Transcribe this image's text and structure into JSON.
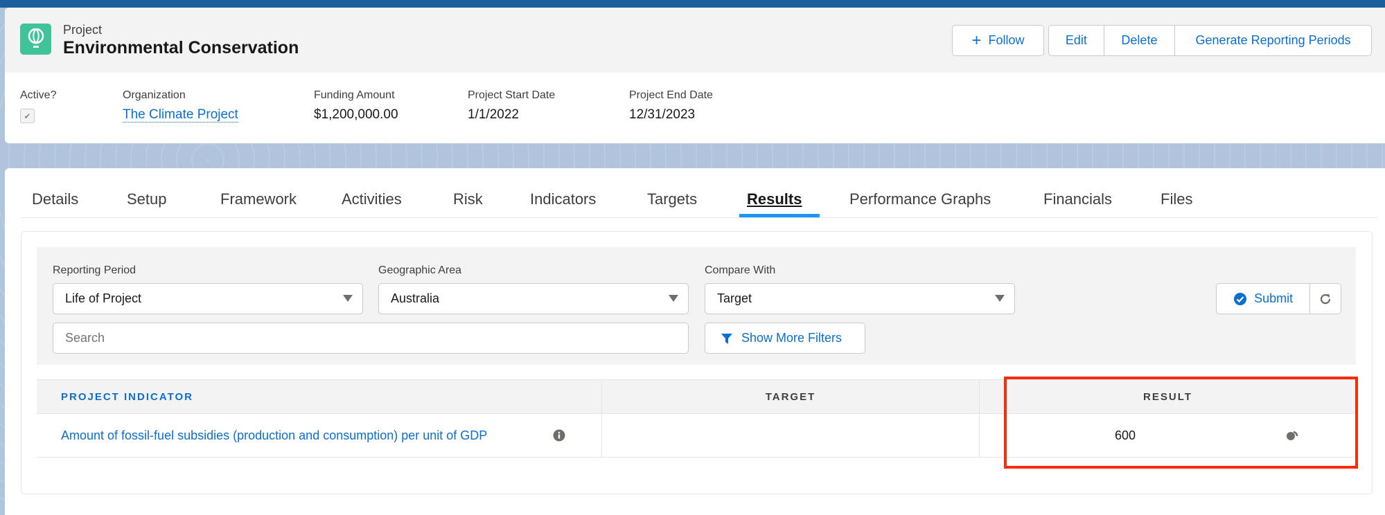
{
  "header": {
    "object_type": "Project",
    "title": "Environmental Conservation",
    "icon": "hot-air-balloon-icon",
    "icon_color": "#41c399",
    "actions": {
      "follow": "Follow",
      "edit": "Edit",
      "delete": "Delete",
      "generate": "Generate Reporting Periods"
    }
  },
  "fields": [
    {
      "label": "Active?",
      "checked": true
    },
    {
      "label": "Organization",
      "value": "The Climate Project"
    },
    {
      "label": "Funding Amount",
      "value": "$1,200,000.00"
    },
    {
      "label": "Project Start Date",
      "value": "1/1/2022"
    },
    {
      "label": "Project End Date",
      "value": "12/31/2023"
    }
  ],
  "tabs": [
    {
      "label": "Details"
    },
    {
      "label": "Setup"
    },
    {
      "label": "Framework"
    },
    {
      "label": "Activities"
    },
    {
      "label": "Risk"
    },
    {
      "label": "Indicators"
    },
    {
      "label": "Targets"
    },
    {
      "label": "Results",
      "active": true
    },
    {
      "label": "Performance Graphs"
    },
    {
      "label": "Financials"
    },
    {
      "label": "Files"
    }
  ],
  "filters": {
    "reporting_period": {
      "label": "Reporting Period",
      "value": "Life of Project"
    },
    "geographic_area": {
      "label": "Geographic Area",
      "value": "Australia"
    },
    "compare_with": {
      "label": "Compare With",
      "value": "Target"
    },
    "search": {
      "placeholder": "Search",
      "value": ""
    },
    "show_more": "Show More Filters",
    "submit": "Submit"
  },
  "table": {
    "columns": [
      "PROJECT INDICATOR",
      "TARGET",
      "RESULT"
    ],
    "rows": [
      {
        "indicator": "Amount of fossil-fuel subsidies (production and consumption) per unit of GDP",
        "target": "",
        "result": "600"
      }
    ]
  },
  "highlight_color": "#ff2a0a",
  "accent_color": "#0b6fd0"
}
